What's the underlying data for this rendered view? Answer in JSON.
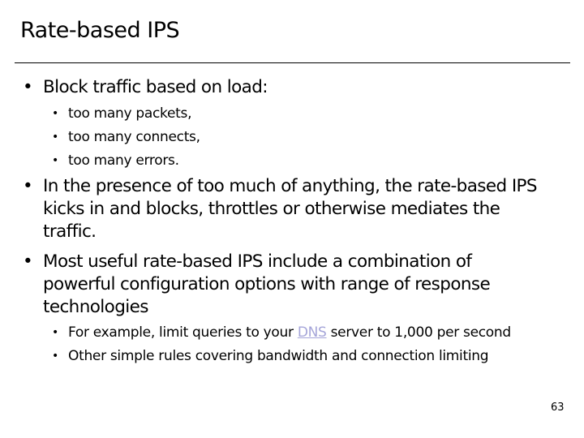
{
  "slide": {
    "title": "Rate-based IPS",
    "page_number": "63",
    "bullet_glyph": "•",
    "bullets": [
      {
        "text": "Block traffic based on load:",
        "sub": [
          "too many packets,",
          "too many connects,",
          "too many errors."
        ]
      },
      {
        "text": "In the presence of too much of anything, the rate-based IPS\nkicks in and blocks, throttles or otherwise mediates the\ntraffic."
      },
      {
        "text": "Most useful rate-based IPS include a combination of\npowerful configuration options with range of response\ntechnologies",
        "sub_rich": {
          "example_before": "For example, limit queries to your ",
          "example_link": "DNS",
          "example_after": " server to 1,000 per second",
          "other": "Other simple rules covering bandwidth and connection limiting"
        }
      }
    ],
    "colors": {
      "text": "#000000",
      "link": "#a5a5d9",
      "background": "#ffffff"
    }
  }
}
